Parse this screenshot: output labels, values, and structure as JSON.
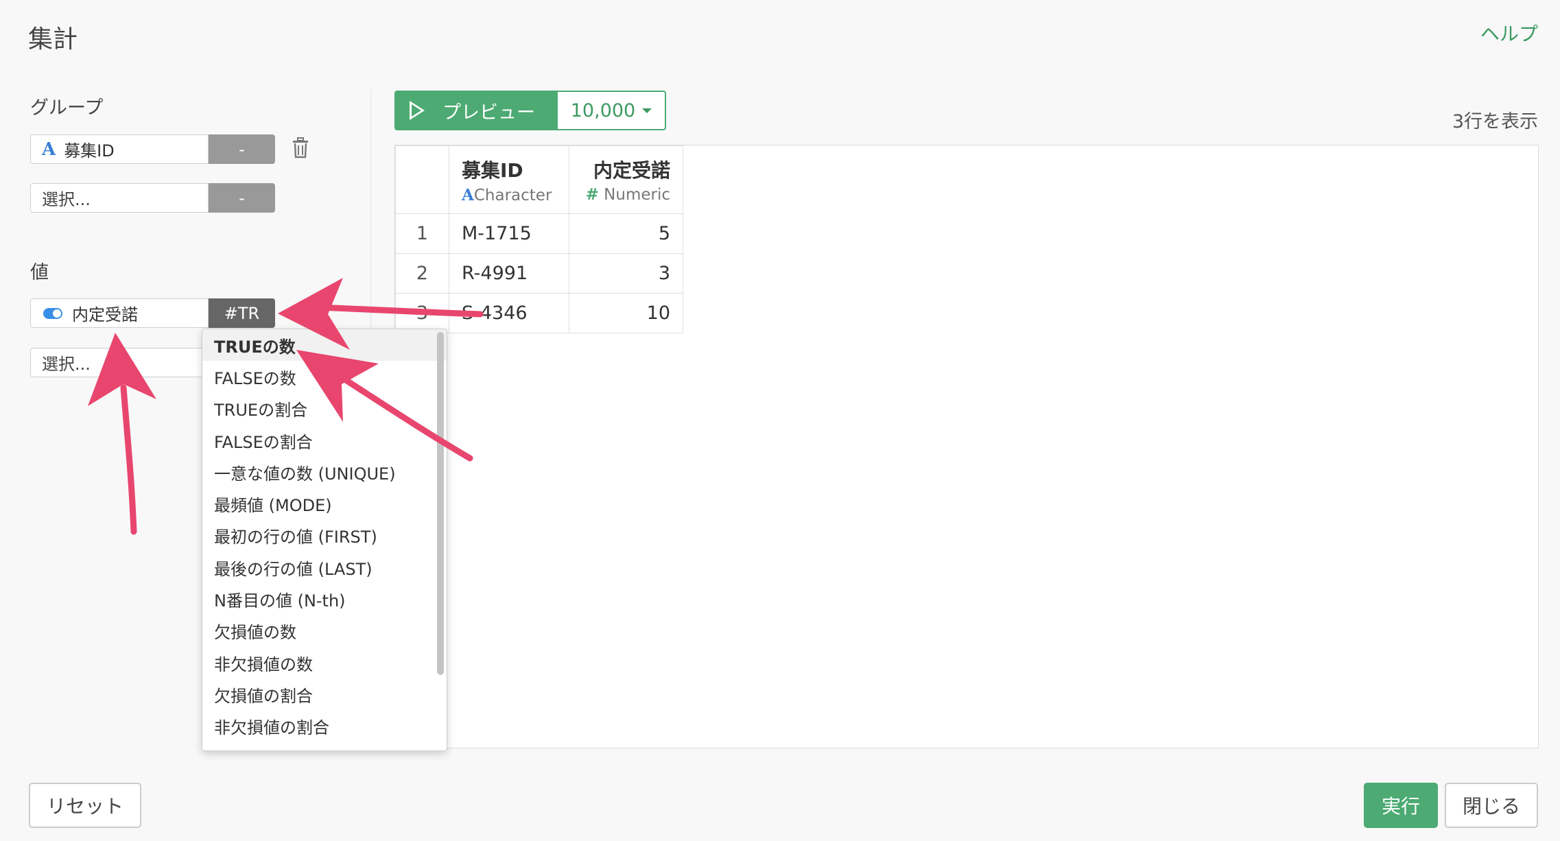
{
  "header": {
    "title": "集計",
    "help_label": "ヘルプ"
  },
  "group": {
    "label": "グループ",
    "fields": [
      {
        "type_icon": "A",
        "value": "募集ID",
        "button": "-"
      },
      {
        "value": "",
        "placeholder": "選択...",
        "button": "-"
      }
    ]
  },
  "values": {
    "label": "値",
    "fields": [
      {
        "type_icon": "toggle-icon",
        "value": "内定受諾",
        "button": "#TR"
      },
      {
        "value": "",
        "placeholder": "選択..."
      }
    ]
  },
  "dropdown": {
    "items": [
      "TRUEの数",
      "FALSEの数",
      "TRUEの割合",
      "FALSEの割合",
      "一意な値の数 (UNIQUE)",
      "最頻値 (MODE)",
      "最初の行の値 (FIRST)",
      "最後の行の値 (LAST)",
      "N番目の値 (N-th)",
      "欠損値の数",
      "非欠損値の数",
      "欠損値の割合",
      "非欠損値の割合"
    ],
    "selected_index": 0
  },
  "preview": {
    "button_label": "プレビュー",
    "rows_value": "10,000",
    "row_count_text": "3行を表示"
  },
  "table": {
    "columns": [
      {
        "name": "募集ID",
        "type_icon": "A",
        "type": "Character"
      },
      {
        "name": "内定受諾",
        "type_icon": "#",
        "type": "Numeric"
      }
    ],
    "rows": [
      {
        "index": "1",
        "id": "M-1715",
        "value": "5"
      },
      {
        "index": "2",
        "id": "R-4991",
        "value": "3"
      },
      {
        "index": "3",
        "id": "S-4346",
        "value": "10"
      }
    ]
  },
  "footer": {
    "reset_label": "リセット",
    "run_label": "実行",
    "close_label": "閉じる"
  },
  "colors": {
    "accent": "#4caa72",
    "annotation_arrow": "#e8466e",
    "type_character": "#3a7fd5"
  }
}
